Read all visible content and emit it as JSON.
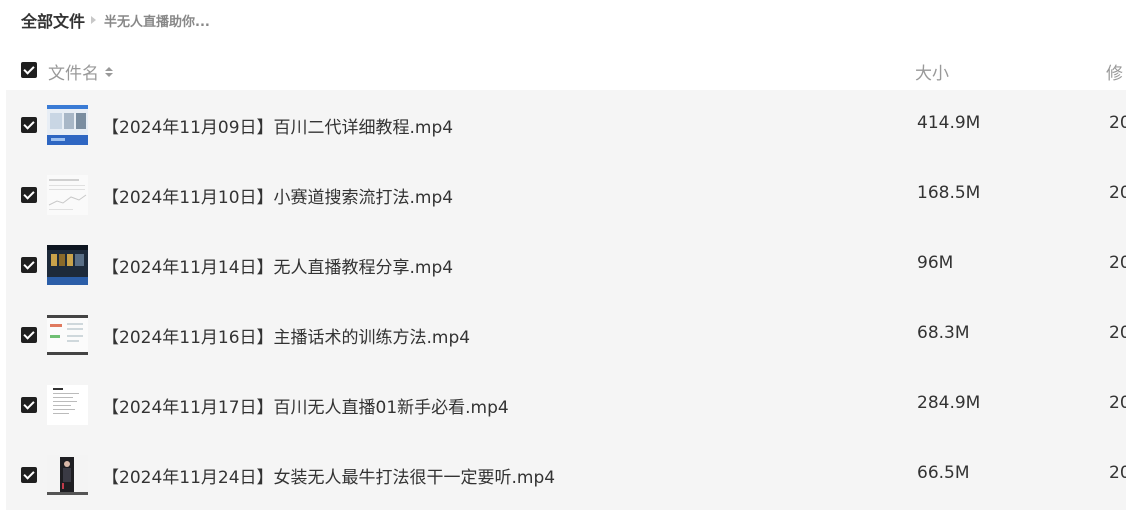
{
  "breadcrumb": {
    "root": "全部文件",
    "current": "半无人直播助你..."
  },
  "table_header": {
    "name_label": "文件名",
    "size_label": "大小",
    "modified_label": "修"
  },
  "files": [
    {
      "name": "【2024年11月09日】百川二代详细教程.mp4",
      "size": "414.9M",
      "modified": "20",
      "thumbnail": "video-thumbnail-blue-ui"
    },
    {
      "name": "【2024年11月10日】小赛道搜索流打法.mp4",
      "size": "168.5M",
      "modified": "20",
      "thumbnail": "video-thumbnail-light-doc"
    },
    {
      "name": "【2024年11月14日】无人直播教程分享.mp4",
      "size": "96M",
      "modified": "20",
      "thumbnail": "video-thumbnail-dark-stream"
    },
    {
      "name": "【2024年11月16日】主播话术的训练方法.mp4",
      "size": "68.3M",
      "modified": "20",
      "thumbnail": "video-thumbnail-mindmap"
    },
    {
      "name": "【2024年11月17日】百川无人直播01新手必看.mp4",
      "size": "284.9M",
      "modified": "20",
      "thumbnail": "video-thumbnail-text-doc"
    },
    {
      "name": "【2024年11月24日】女装无人最牛打法很干一定要听.mp4",
      "size": "66.5M",
      "modified": "20",
      "thumbnail": "video-thumbnail-fashion"
    }
  ]
}
